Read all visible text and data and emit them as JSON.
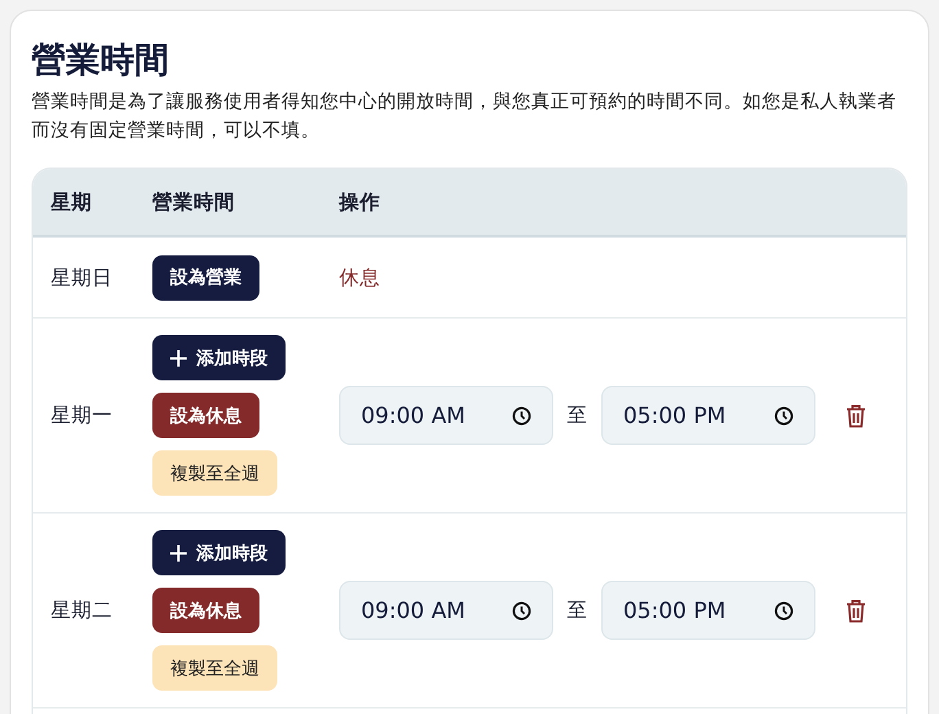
{
  "title": "營業時間",
  "description": "營業時間是為了讓服務使用者得知您中心的開放時間，與您真正可預約的時間不同。如您是私人執業者而沒有固定營業時間，可以不填。",
  "table": {
    "columns": [
      "星期",
      "營業時間",
      "操作"
    ],
    "rows": [
      {
        "day": "星期日",
        "kind": "closed",
        "open_button": "設為營業",
        "status": "休息"
      },
      {
        "day": "星期一",
        "kind": "open",
        "add_button": "添加時段",
        "close_button": "設為休息",
        "copy_button": "複製至全週",
        "slots": [
          {
            "start": "09:00 AM",
            "separator": "至",
            "end": "05:00 PM"
          }
        ]
      },
      {
        "day": "星期二",
        "kind": "open",
        "add_button": "添加時段",
        "close_button": "設為休息",
        "copy_button": "複製至全週",
        "slots": [
          {
            "start": "09:00 AM",
            "separator": "至",
            "end": "05:00 PM"
          }
        ]
      }
    ]
  }
}
